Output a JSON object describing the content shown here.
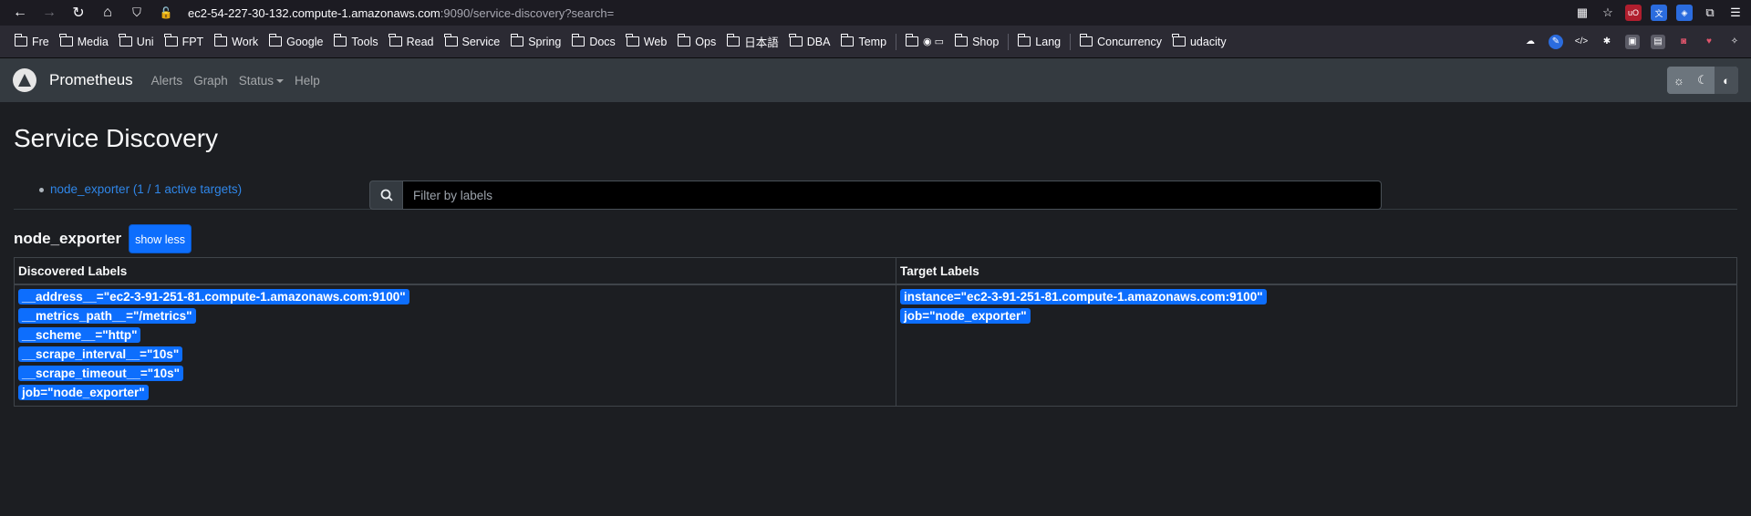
{
  "browser": {
    "url_host": "ec2-54-227-30-132.compute-1.amazonaws.com",
    "url_rest": ":9090/service-discovery?search=",
    "bookmarks": [
      "Fre",
      "Media",
      "Uni",
      "FPT",
      "Work",
      "Google",
      "Tools",
      "Read",
      "Service",
      "Spring",
      "Docs",
      "Web",
      "Ops",
      "日本語",
      "DBA",
      "Temp",
      "",
      "Shop",
      "Lang",
      "Concurrency",
      "udacity"
    ]
  },
  "navbar": {
    "brand": "Prometheus",
    "links": [
      "Alerts",
      "Graph",
      "Status",
      "Help"
    ]
  },
  "page": {
    "title": "Service Discovery",
    "filter_placeholder": "Filter by labels",
    "job_link": "node_exporter (1 / 1 active targets)"
  },
  "job": {
    "name": "node_exporter",
    "toggle_label": "show less",
    "headers": {
      "discovered": "Discovered Labels",
      "target": "Target Labels"
    },
    "discovered_labels": [
      "__address__=\"ec2-3-91-251-81.compute-1.amazonaws.com:9100\"",
      "__metrics_path__=\"/metrics\"",
      "__scheme__=\"http\"",
      "__scrape_interval__=\"10s\"",
      "__scrape_timeout__=\"10s\"",
      "job=\"node_exporter\""
    ],
    "target_labels": [
      "instance=\"ec2-3-91-251-81.compute-1.amazonaws.com:9100\"",
      "job=\"node_exporter\""
    ]
  },
  "colors": {
    "accent": "#0d6efd",
    "link": "#2f86e8",
    "navbar": "#343a40",
    "background": "#1c1e22"
  }
}
